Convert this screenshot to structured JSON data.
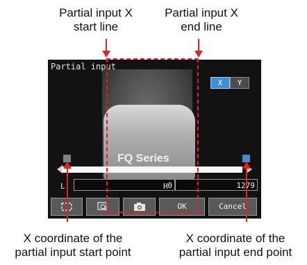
{
  "annotations": {
    "start_line": [
      "Partial input X",
      "start line"
    ],
    "end_line": [
      "Partial input X",
      "end line"
    ],
    "start_point": [
      "X coordinate of the",
      "partial input start point"
    ],
    "end_point": [
      "X coordinate of the",
      "partial input end point"
    ]
  },
  "screen": {
    "title": "Partial input",
    "axis_buttons": {
      "x": "X",
      "y": "Y",
      "selected": "X"
    },
    "product_label": "FQ Series",
    "fields": {
      "l_label": "L",
      "l_value": "0",
      "h_label": "H",
      "h_value": "1279"
    },
    "buttons": {
      "ok": "OK",
      "cancel": "Cancel"
    },
    "icons": [
      "region-icon",
      "zoom-icon",
      "camera-icon"
    ]
  },
  "colors": {
    "accent": "#3a90d6",
    "annotation_red": "#e62020",
    "screen_bg": "#121212"
  }
}
